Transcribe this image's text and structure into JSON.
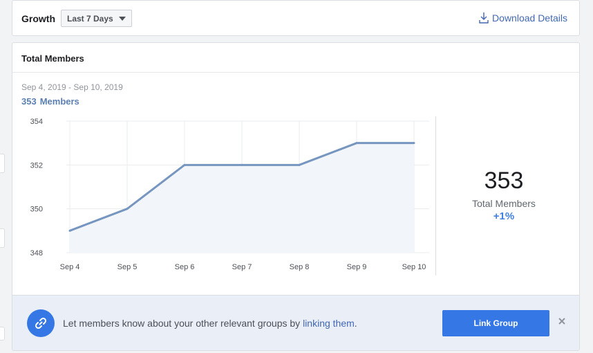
{
  "header": {
    "title": "Growth",
    "range_select": "Last 7 Days",
    "download_label": "Download Details"
  },
  "card": {
    "title": "Total Members",
    "date_range": "Sep 4, 2019 - Sep 10, 2019",
    "members_count": "353",
    "members_label": "Members"
  },
  "summary": {
    "value": "353",
    "label": "Total Members",
    "change": "+1%"
  },
  "banner": {
    "text_before": "Let members know about your other relevant groups by ",
    "link_text": "linking them",
    "text_after": ".",
    "button_label": "Link Group"
  },
  "icons": {
    "download": "download-icon",
    "link": "link-icon",
    "close": "close-icon",
    "caret": "chevron-down-icon"
  },
  "colors": {
    "accent": "#3578e5",
    "line": "#7696c0",
    "fill": "#f2f5fa",
    "link": "#4267b2",
    "change": "#4080e0"
  },
  "chart_data": {
    "type": "area",
    "categories": [
      "Sep 4",
      "Sep 5",
      "Sep 6",
      "Sep 7",
      "Sep 8",
      "Sep 9",
      "Sep 10"
    ],
    "series": [
      {
        "values": [
          349,
          350,
          352,
          352,
          352,
          353,
          353
        ]
      }
    ],
    "ylim": [
      348,
      354
    ],
    "yticks": [
      348,
      350,
      352,
      354
    ],
    "grid": true
  }
}
